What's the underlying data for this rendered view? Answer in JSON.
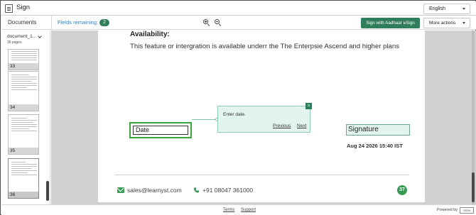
{
  "header": {
    "app_title": "Sign",
    "language": "English"
  },
  "toolbar": {
    "documents_label": "Documents",
    "fields_remaining_label": "Fields remaining:",
    "fields_remaining_count": "2",
    "aadhaar_button": "Sign with Aadhaar eSign",
    "more_actions": "More actions"
  },
  "sidebar": {
    "document_name": "document_1...",
    "page_count": "36 pages",
    "thumbnails": [
      {
        "page": "33"
      },
      {
        "page": "34"
      },
      {
        "page": "35"
      },
      {
        "page": "36"
      }
    ]
  },
  "document": {
    "section_title": "Availability:",
    "section_text": "This feature or intergration is available underr the The Enterpsie Ascend and higher plans",
    "date_field_label": "Date",
    "tooltip_message": "Enter date.",
    "tooltip_previous": "Previous",
    "tooltip_next": "Next",
    "tooltip_close": "×",
    "signature_label": "Signature",
    "signature_date": "Aug 24 2026 15:40 IST",
    "footer_email": "sales@learnyst.com",
    "footer_phone": "+91 08047 361000",
    "page_number": "37"
  },
  "footer": {
    "terms": "Terms",
    "support": "Support",
    "powered_by": "Powered by",
    "logo_text": "SIGN"
  },
  "colors": {
    "accent_green": "#2f7d5a",
    "field_green": "#3aa53a",
    "tooltip_bg": "#e3f3ee"
  }
}
